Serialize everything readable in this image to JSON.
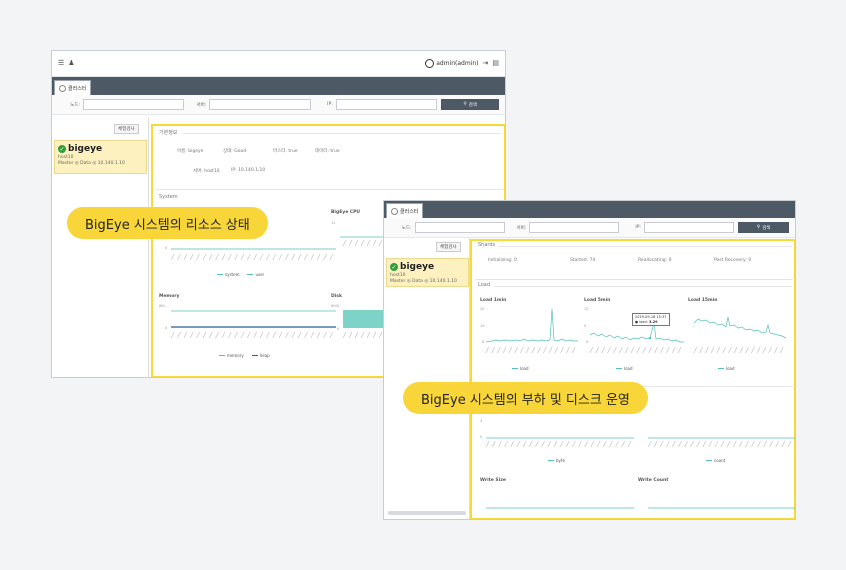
{
  "window_a": {
    "user_label": "admin(admin)",
    "nav_tab": "클러스터",
    "filters": {
      "node_label": "노드:",
      "server_label": "서버:",
      "ip_label": "IP:",
      "search_label": "검색"
    },
    "sidebar_button": "체험검사",
    "node": {
      "name": "bigeye",
      "host": "host10",
      "role_ip": "Master ◎ Data ◎ 10.140.1.10"
    },
    "basic_info": {
      "title": "기본정보",
      "name": "이름: bigeye",
      "state": "상태: Good",
      "master": "마스터: true",
      "data": "데이터: true",
      "server": "서버: host10",
      "ip": "IP: 10.140.1.10"
    },
    "system": {
      "title": "System",
      "charts": [
        {
          "title": "",
          "y_top": "",
          "y_zero": "0",
          "legend": [
            "system",
            "user"
          ]
        },
        {
          "title": "BigEye CPU",
          "y_top": "12",
          "y_zero": "0",
          "legend": []
        },
        {
          "title": "Memory",
          "y_top": "8KL",
          "y_zero": "0",
          "legend": [
            "memory",
            "heap"
          ]
        },
        {
          "title": "Disk",
          "y_top": "600L",
          "y_zero": "0",
          "legend": []
        }
      ]
    }
  },
  "window_b": {
    "nav_tab": "클러스터",
    "filters": {
      "node_label": "노드:",
      "server_label": "서버:",
      "ip_label": "IP:",
      "search_label": "검색"
    },
    "sidebar_button": "체험검사",
    "node": {
      "name": "bigeye",
      "host": "host10",
      "role_ip": "Master ◎ Data ◎ 10.140.1.10"
    },
    "shards": {
      "title": "Shards",
      "initializing": "Initializing: 0",
      "started": "Started: 74",
      "reallocating": "Reallocating: 0",
      "post_recovery": "Post Recovery: 0"
    },
    "load": {
      "title": "Load",
      "charts": [
        {
          "title": "Load 1min",
          "y_top": "20",
          "y_mid": "10",
          "y_zero": "0",
          "legend": "load"
        },
        {
          "title": "Load 5min",
          "y_top": "10",
          "y_mid": "5",
          "y_zero": "0",
          "legend": "load"
        },
        {
          "title": "Load 15min",
          "y_top": "",
          "y_mid": "",
          "y_zero": "",
          "legend": "load"
        }
      ],
      "tooltip": {
        "date": "2019-09-18 15:37",
        "label": "● load:",
        "value": "3.29"
      }
    },
    "disk": {
      "legend_left": "byte",
      "legend_right": "count",
      "write_size": "Write Size",
      "write_count": "Write Count",
      "y_top": "4",
      "y_zero": "0"
    }
  },
  "callouts": {
    "top": "BigEye 시스템의 리소스 상태",
    "bottom": "BigEye 시스템의 부하 및 디스크 운영"
  }
}
